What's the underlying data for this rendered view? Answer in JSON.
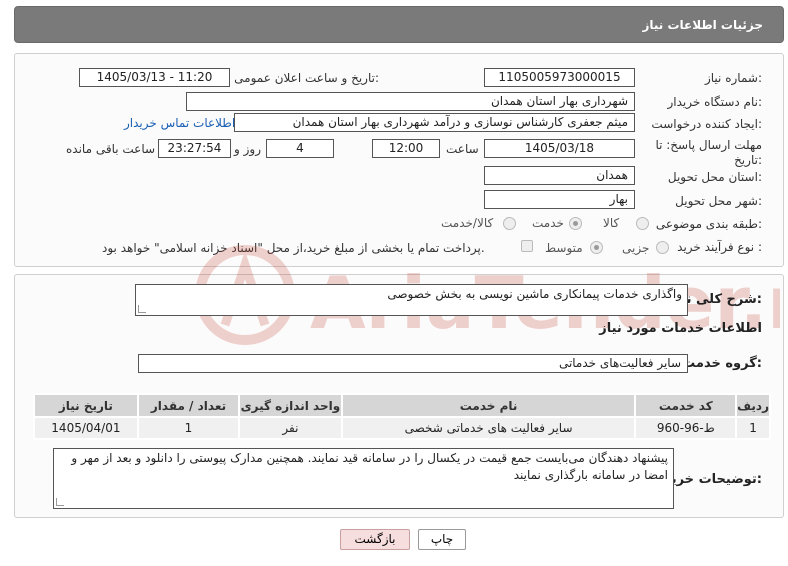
{
  "header": {
    "title": "جزئیات اطلاعات نیاز"
  },
  "form": {
    "need_number_label": "شماره نیاز:",
    "need_number": "1105005973000015",
    "announce_label": "تاریخ و ساعت اعلان عمومی:",
    "announce_value": "1405/03/13 - 11:20",
    "buyer_org_label": "نام دستگاه خریدار:",
    "buyer_org": "شهرداری بهار استان همدان",
    "creator_label": "ایجاد کننده درخواست:",
    "creator": "میثم جعفری کارشناس نوسازی و درآمد شهرداری بهار استان همدان",
    "contact_link": "اطلاعات تماس خریدار",
    "deadline_label": "مهلت ارسال پاسخ: تا تاریخ:",
    "deadline_date": "1405/03/18",
    "time_label": "ساعت",
    "deadline_time": "12:00",
    "days_value": "4",
    "days_label": "روز و",
    "remaining_time": "23:27:54",
    "remaining_label": "ساعت باقی مانده",
    "province_label": "استان محل تحویل:",
    "province": "همدان",
    "city_label": "شهر محل تحویل:",
    "city": "بهار",
    "category_label": "طبقه بندی موضوعی:",
    "category_options": [
      "کالا",
      "خدمت",
      "کالا/خدمت"
    ],
    "category_selected": "خدمت",
    "process_label": "نوع فرآیند خرید :",
    "process_options": [
      "جزیی",
      "متوسط"
    ],
    "process_selected": "متوسط",
    "payment_note": "پرداخت تمام یا بخشی از مبلغ خرید،از محل \"اسناد خزانه اسلامی\" خواهد بود."
  },
  "details": {
    "summary_label": "شرح کلی نیاز:",
    "summary": "واگذاری خدمات پیمانکاری ماشین نویسی به بخش خصوصی",
    "services_info_label": "اطلاعات خدمات مورد نیاز",
    "service_group_label": "گروه خدمت:",
    "service_group": "سایر فعالیت‌های خدماتی",
    "table": {
      "headers": [
        "ردیف",
        "کد خدمت",
        "نام خدمت",
        "واحد اندازه گیری",
        "تعداد / مقدار",
        "تاریخ نیاز"
      ],
      "rows": [
        [
          "1",
          "ط-96-960",
          "سایر فعالیت های خدماتی شخصی",
          "نفر",
          "1",
          "1405/04/01"
        ]
      ]
    },
    "buyer_notes_label": "توضیحات خریدار:",
    "buyer_notes": "پیشنهاد دهندگان می‌بایست جمع قیمت در یکسال را در سامانه قید نمایند. همچنین مدارک پیوستی را دانلود و بعد از مهر و امضا در سامانه بارگذاری نمایند"
  },
  "buttons": {
    "print": "چاپ",
    "back": "بازگشت"
  },
  "watermark": {
    "text": "AriaTender.neT"
  },
  "colors": {
    "header_bg": "#7a7a7a",
    "link": "#1a5fb4",
    "back_button_bg": "#f7dede",
    "watermark": "#c0392b"
  }
}
